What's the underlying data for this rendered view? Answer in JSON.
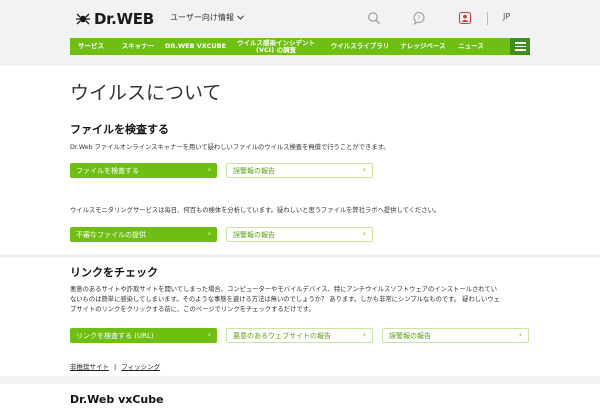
{
  "header": {
    "brand": "Dr.WEB",
    "segment": "ユーザー向け情報",
    "lang": "JP",
    "icons": [
      "search-icon",
      "chat-icon",
      "account-icon"
    ],
    "accent": "#6fbe12",
    "accent_dark": "#3f8d1a"
  },
  "nav": {
    "items": [
      {
        "label": "サービス"
      },
      {
        "label": "スキャナー"
      },
      {
        "label": "DR.WEB VXCUBE"
      },
      {
        "label": "ウイルス感染インシデント (VCI) の調査"
      },
      {
        "label": "ウイルスライブラリ"
      },
      {
        "label": "ナレッジベース"
      },
      {
        "label": "ニュース"
      }
    ]
  },
  "main": {
    "title": "ウイルスについて",
    "file_check": {
      "heading": "ファイルを検査する",
      "description": "Dr.Web ファイルオンラインスキャナーを用いて疑わしいファイルのウイルス検査を無償で行うことができます。",
      "primary_button": "ファイルを検査する",
      "secondary_button": "誤警報の報告"
    },
    "monitoring": {
      "description": "ウイルスモニタリングサービスは毎日、何百もの検体を分析しています。疑わしいと思うファイルを弊社ラボへ提供してください。",
      "primary_button": "不審なファイルの提供",
      "secondary_button": "誤警報の報告"
    }
  },
  "link_check": {
    "heading": "リンクをチェック",
    "description_lines": [
      "悪意のあるサイトや詐欺サイトを開いてしまった場合、コンピューターやモバイルデバイス、特にアンチウイルスソフトウェアのインストールされてい",
      "ないものは簡単に感染してしまいます。そのような事態を避ける方法は無いのでしょうか？ あります。しかも非常にシンプルなものです。 疑わしいウェ",
      "ブサイトのリンクをクリックする前に、このページでリンクをチェックするだけです。"
    ],
    "primary_button": "リンクを検査する (URL)",
    "malicious_button": "悪意のあるウェブサイトの報告",
    "secondary_button": "誤警報の報告",
    "footer_links": [
      "非推奨サイト",
      "フィッシング"
    ],
    "separator": "|"
  },
  "vxcube": {
    "heading": "Dr.Web vxCube"
  }
}
